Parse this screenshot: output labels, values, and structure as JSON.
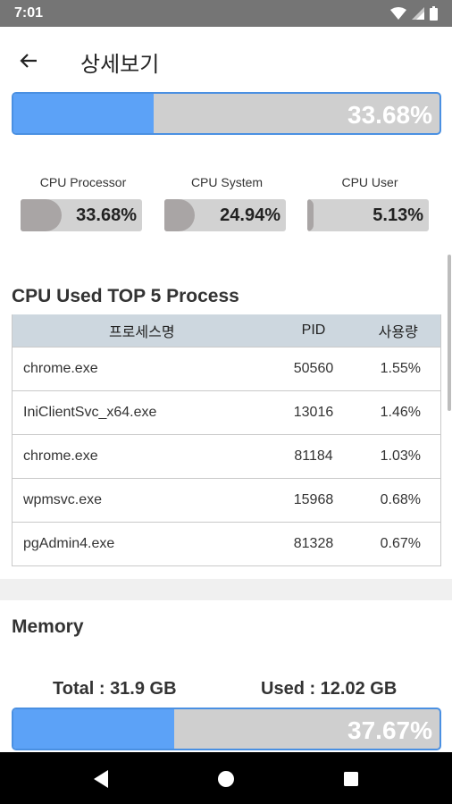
{
  "status_bar": {
    "time": "7:01",
    "icons": [
      "wifi-icon",
      "signal-icon",
      "battery-icon"
    ]
  },
  "app_bar": {
    "back_icon": "arrow-left-icon",
    "title": "상세보기"
  },
  "cpu": {
    "total_usage": "33.68%",
    "total_fraction": 0.33,
    "gauges": [
      {
        "label": "CPU Processor",
        "value": "33.68%",
        "fraction": 0.3368
      },
      {
        "label": "CPU System",
        "value": "24.94%",
        "fraction": 0.2494
      },
      {
        "label": "CPU User",
        "value": "5.13%",
        "fraction": 0.0513
      }
    ]
  },
  "process_section": {
    "title": "CPU Used TOP 5 Process",
    "headers": {
      "name": "프로세스명",
      "pid": "PID",
      "usage": "사용량"
    },
    "rows": [
      {
        "name": "chrome.exe",
        "pid": "50560",
        "usage": "1.55%"
      },
      {
        "name": "IniClientSvc_x64.exe",
        "pid": "13016",
        "usage": "1.46%"
      },
      {
        "name": "chrome.exe",
        "pid": "81184",
        "usage": "1.03%"
      },
      {
        "name": "wpmsvc.exe",
        "pid": "15968",
        "usage": "0.68%"
      },
      {
        "name": "pgAdmin4.exe",
        "pid": "81328",
        "usage": "0.67%"
      }
    ]
  },
  "memory": {
    "title": "Memory",
    "total": "Total : 31.9 GB",
    "used": "Used : 12.02 GB",
    "usage": "37.67%",
    "fraction": 0.3767
  },
  "colors": {
    "bar_fill": "#5ca2f7",
    "bar_border": "#4a90e2",
    "bar_track": "#cfcfcf",
    "table_header": "#cdd7df",
    "gauge_fill": "#a9a5a5"
  },
  "nav_bar": {
    "icons": [
      "back-triangle-icon",
      "home-circle-icon",
      "recents-square-icon"
    ]
  }
}
